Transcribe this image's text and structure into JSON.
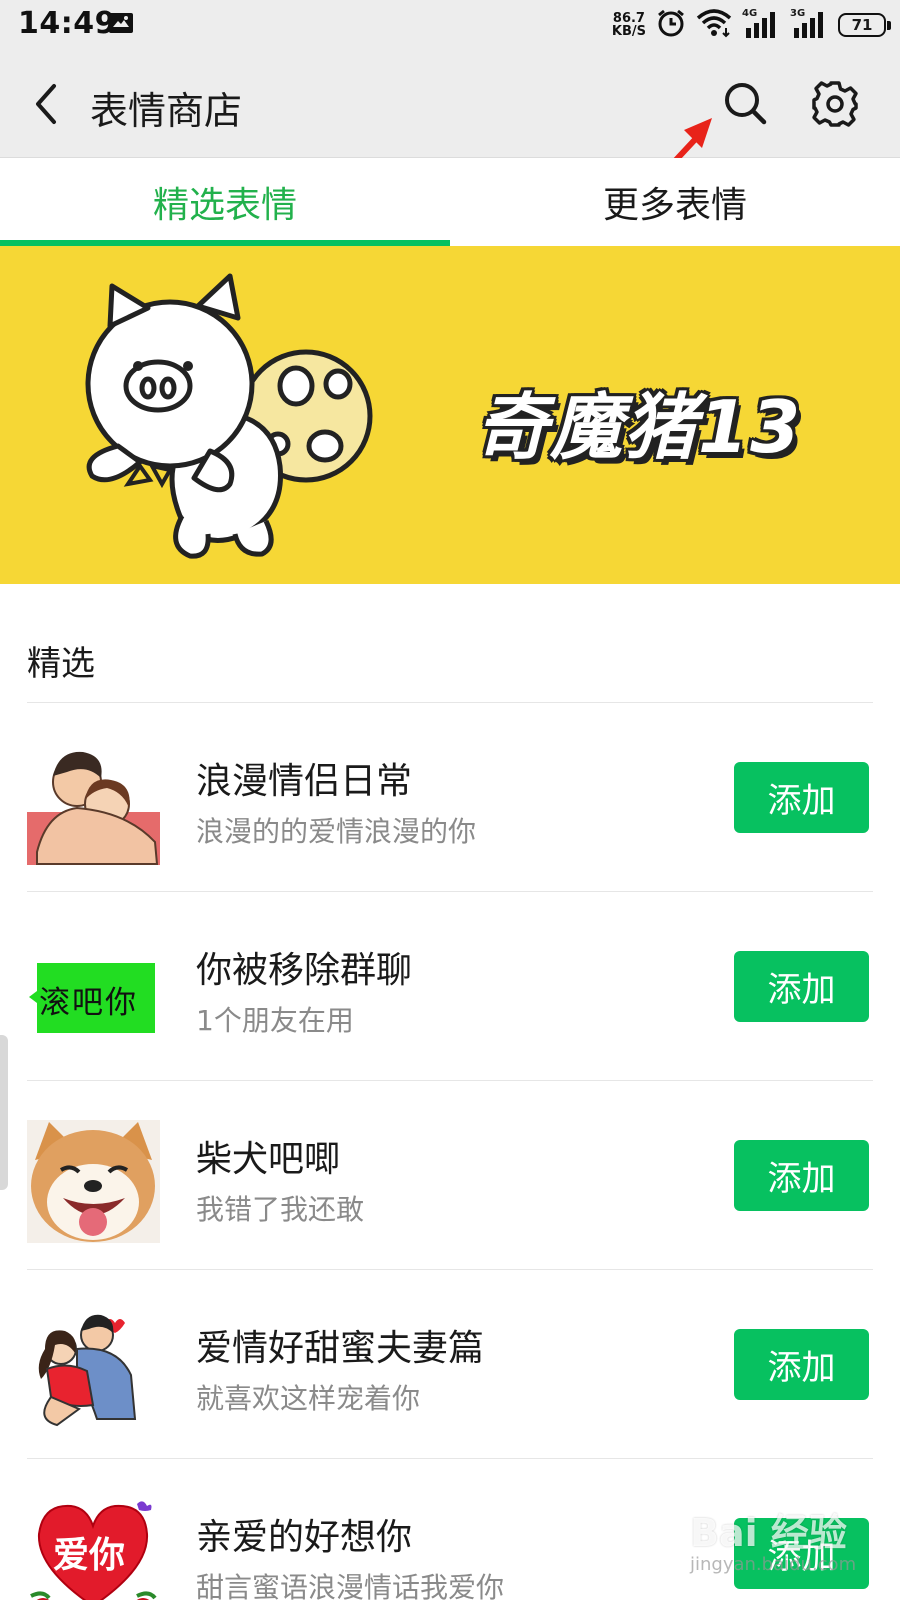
{
  "status_bar": {
    "time": "14:49",
    "net_speed_value": "86.7",
    "net_speed_unit": "KB/S",
    "signal_1_label": "4G",
    "signal_2_label": "3G",
    "battery_level": "71"
  },
  "header": {
    "title": "表情商店"
  },
  "tabs": [
    {
      "label": "精选表情",
      "active": true
    },
    {
      "label": "更多表情",
      "active": false
    }
  ],
  "banner": {
    "title": "奇魔猪13",
    "background_color": "#f6d735"
  },
  "section": {
    "title": "精选"
  },
  "items": [
    {
      "title": "浪漫情侣日常",
      "subtitle": "浪漫的的爱情浪漫的你",
      "button": "添加",
      "thumb_icon": "romantic-couple-icon"
    },
    {
      "title": "你被移除群聊",
      "subtitle": "1个朋友在用",
      "button": "添加",
      "thumb_icon": "chat-bubble-icon",
      "thumb_text": "滚吧你"
    },
    {
      "title": "柴犬吧唧",
      "subtitle": "我错了我还敢",
      "button": "添加",
      "thumb_icon": "shiba-dog-icon"
    },
    {
      "title": "爱情好甜蜜夫妻篇",
      "subtitle": "就喜欢这样宠着你",
      "button": "添加",
      "thumb_icon": "sweet-couple-icon"
    },
    {
      "title": "亲爱的好想你",
      "subtitle": "甜言蜜语浪漫情话我爱你",
      "button": "添加",
      "thumb_icon": "heart-roses-icon",
      "thumb_text": "爱你"
    }
  ],
  "watermark": {
    "main": "Bai 经验",
    "sub": "jingyan.baidu.com"
  },
  "colors": {
    "accent": "#07c160",
    "active_tab_text": "#22b14c",
    "header_bg": "#ededed"
  }
}
